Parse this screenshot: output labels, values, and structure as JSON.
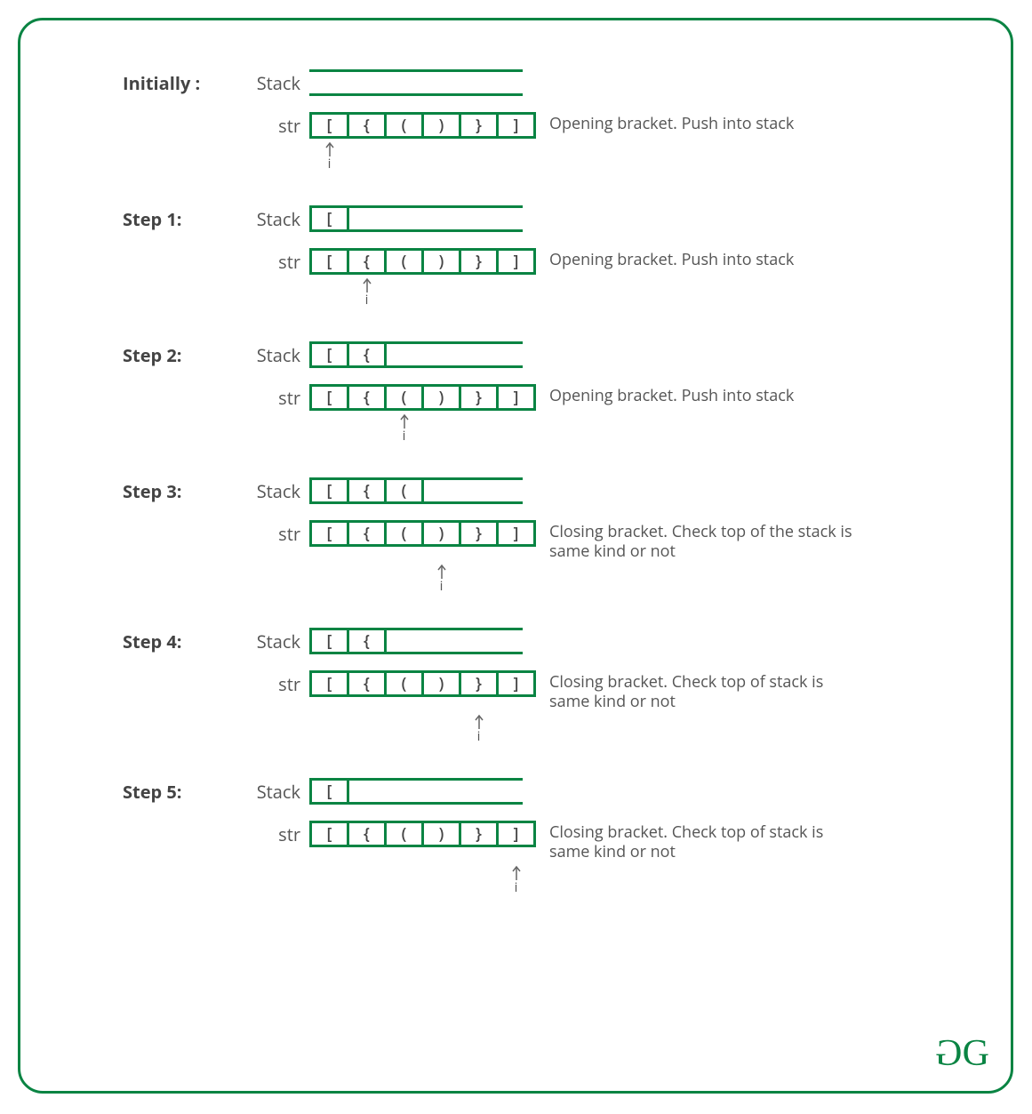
{
  "labels": {
    "stack": "Stack",
    "str": "str",
    "pointer": "i"
  },
  "str_chars": [
    "[",
    "{",
    "(",
    ")",
    "}",
    "]"
  ],
  "steps": [
    {
      "title": "Initially :",
      "stack": [],
      "ptr": 0,
      "desc": "Opening bracket. Push into stack"
    },
    {
      "title": "Step 1:",
      "stack": [
        "["
      ],
      "ptr": 1,
      "desc": "Opening bracket. Push into stack"
    },
    {
      "title": "Step 2:",
      "stack": [
        "[",
        "{"
      ],
      "ptr": 2,
      "desc": "Opening bracket. Push into stack"
    },
    {
      "title": "Step 3:",
      "stack": [
        "[",
        "{",
        "("
      ],
      "ptr": 3,
      "desc": "Closing bracket. Check top of the stack is same kind or not"
    },
    {
      "title": "Step 4:",
      "stack": [
        "[",
        "{"
      ],
      "ptr": 4,
      "desc": "Closing bracket. Check top of stack is same kind or not"
    },
    {
      "title": "Step 5:",
      "stack": [
        "["
      ],
      "ptr": 5,
      "desc": "Closing bracket. Check top of stack is same kind or not"
    }
  ],
  "colors": {
    "green": "#0a8443",
    "text": "#555555"
  }
}
